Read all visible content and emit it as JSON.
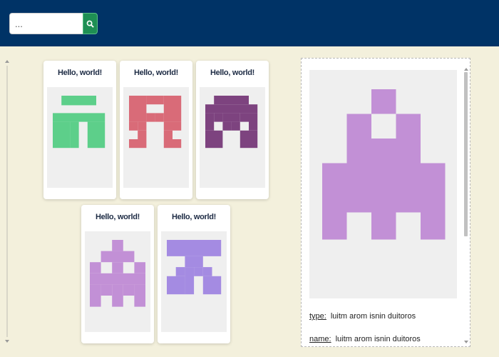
{
  "search": {
    "placeholder": "...",
    "button_icon": "search-icon"
  },
  "cards": [
    {
      "title": "Hello, world!",
      "color": "#5dcf8a",
      "pattern": "T"
    },
    {
      "title": "Hello, world!",
      "color": "#d96b78",
      "pattern": "M"
    },
    {
      "title": "Hello, world!",
      "color": "#7d437f",
      "pattern": "A"
    },
    {
      "title": "Hello, world!",
      "color": "#c290d6",
      "pattern": "tree"
    },
    {
      "title": "Hello, world!",
      "color": "#a48be2",
      "pattern": "pi"
    }
  ],
  "detail": {
    "color": "#c290d6",
    "fields": [
      {
        "key": "type:",
        "value": "luitm arom isnin duitoros"
      },
      {
        "key": "name:",
        "value": "luitm arom isnin duitoros"
      }
    ]
  }
}
